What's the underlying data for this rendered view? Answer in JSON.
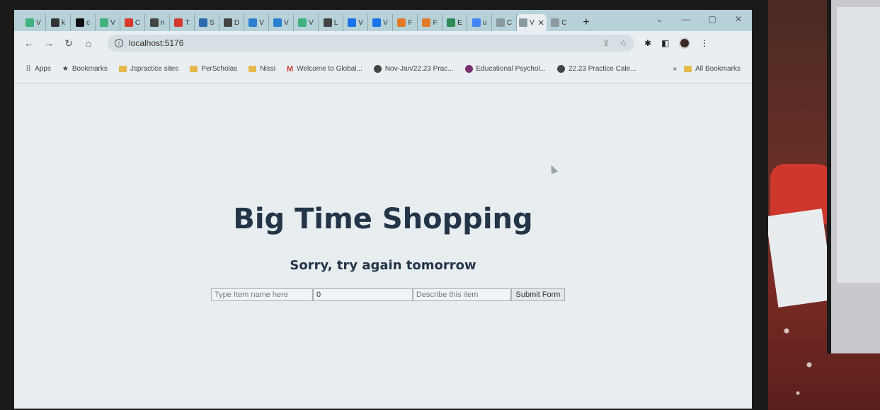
{
  "tabs": [
    {
      "icon": "vue-icon",
      "label": "V",
      "color": "#3fb27f"
    },
    {
      "icon": "square-icon",
      "label": "k",
      "color": "#333333"
    },
    {
      "icon": "github-icon",
      "label": "c",
      "color": "#111111"
    },
    {
      "icon": "vue-icon",
      "label": "V",
      "color": "#3fb27f"
    },
    {
      "icon": "red-square-icon",
      "label": "C",
      "color": "#d9382e"
    },
    {
      "icon": "globe-icon",
      "label": "n",
      "color": "#444444"
    },
    {
      "icon": "gmail-icon",
      "label": "T",
      "color": "#d23a2f"
    },
    {
      "icon": "p-icon",
      "label": "S",
      "color": "#2b6cb0"
    },
    {
      "icon": "globe-icon",
      "label": "D",
      "color": "#444444"
    },
    {
      "icon": "vscode-icon",
      "label": "V",
      "color": "#2b7fd1"
    },
    {
      "icon": "vscode-icon",
      "label": "V",
      "color": "#2b7fd1"
    },
    {
      "icon": "vue-icon",
      "label": "V",
      "color": "#3fb27f"
    },
    {
      "icon": "doc-icon",
      "label": "L",
      "color": "#444444"
    },
    {
      "icon": "c-icon",
      "label": "V",
      "color": "#1a73e8"
    },
    {
      "icon": "c-icon",
      "label": "V",
      "color": "#1a73e8"
    },
    {
      "icon": "orange-check-icon",
      "label": "F",
      "color": "#e07b2a"
    },
    {
      "icon": "orange-square-icon",
      "label": "F",
      "color": "#e07b2a"
    },
    {
      "icon": "infinity-icon",
      "label": "E",
      "color": "#2e8b57"
    },
    {
      "icon": "google-icon",
      "label": "u",
      "color": "#4285f4"
    },
    {
      "icon": "grey-square-icon",
      "label": "C",
      "color": "#8a9a9f"
    }
  ],
  "active_tab": {
    "icon": "grey-square-icon",
    "label": "V",
    "close": "✕",
    "color": "#8a9a9f"
  },
  "last_tab": {
    "icon": "grey-square-icon",
    "label": "C",
    "color": "#8a9a9f"
  },
  "new_tab": "+",
  "address_bar": {
    "url": "localhost:5176"
  },
  "bookmarks": {
    "apps": "Apps",
    "bookmarks": "Bookmarks",
    "items": [
      {
        "icon": "folder-icon",
        "label": "Jspractice sites"
      },
      {
        "icon": "folder-icon",
        "label": "PerScholas"
      },
      {
        "icon": "folder-icon",
        "label": "Nissi"
      },
      {
        "icon": "gmail-icon",
        "label": "Welcome to Global..."
      },
      {
        "icon": "globe-icon",
        "label": "Nov-Jan/22.23 Prac..."
      },
      {
        "icon": "pinterest-icon",
        "label": "Educational Psychol..."
      },
      {
        "icon": "globe-icon",
        "label": "22.23 Practice Cale..."
      }
    ],
    "overflow": "»",
    "all_bookmarks": "All Bookmarks"
  },
  "page": {
    "title": "Big Time Shopping",
    "subtitle": "Sorry, try again tomorrow",
    "form": {
      "name_placeholder": "Type Item name here",
      "price_value": "0",
      "description_placeholder": "Describe this item",
      "submit_label": "Submit Form"
    }
  }
}
